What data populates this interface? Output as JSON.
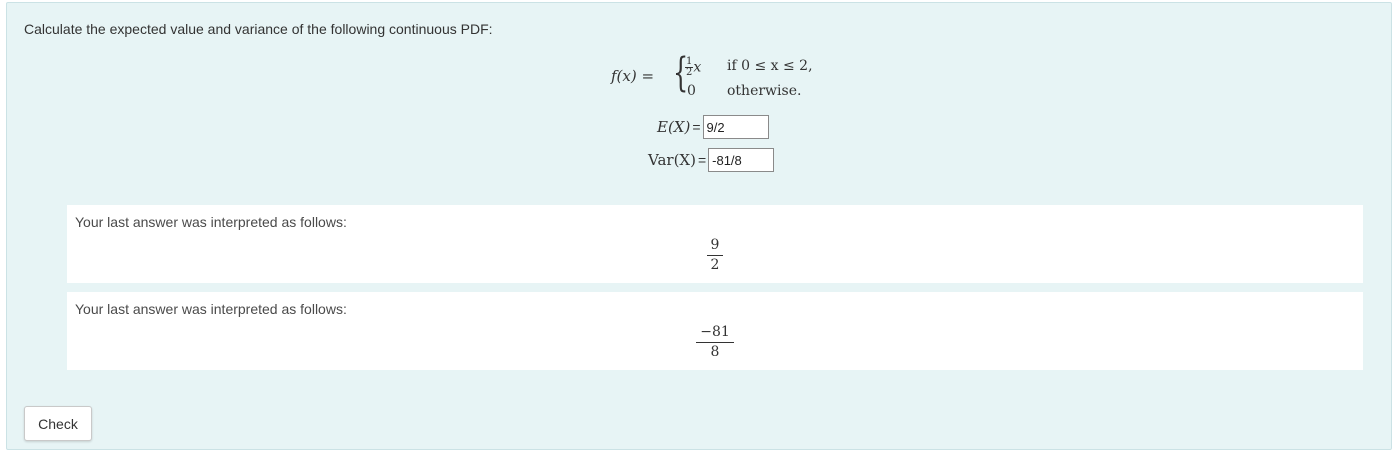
{
  "question": {
    "text": "Calculate the expected value and variance of the following continuous PDF:"
  },
  "pdf": {
    "lhs": "f(x) =",
    "case1_num": "1",
    "case1_den": "2",
    "case1_var": "x",
    "case1_condition": "if 0 ≤ x ≤ 2,",
    "case2_value": "0",
    "case2_condition": "otherwise."
  },
  "answers": {
    "expected_label": "E(X)",
    "expected_eq": "=",
    "expected_value": "9/2",
    "variance_label": "Var(X)",
    "variance_eq": "=",
    "variance_value": "-81/8"
  },
  "feedback": [
    {
      "label": "Your last answer was interpreted as follows:",
      "numerator": "9",
      "denominator": "2"
    },
    {
      "label": "Your last answer was interpreted as follows:",
      "numerator": "−81",
      "denominator": "8"
    }
  ],
  "check_button": {
    "label": "Check"
  }
}
